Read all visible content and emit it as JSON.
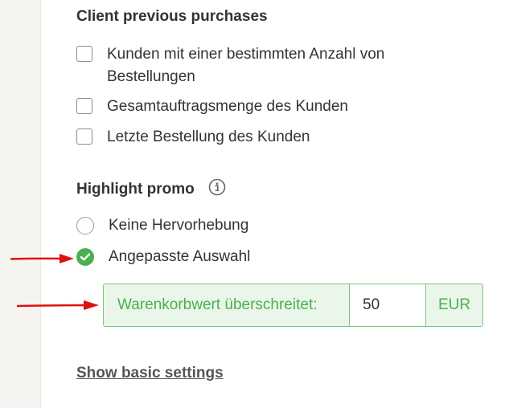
{
  "purchases": {
    "title": "Client previous purchases",
    "options": [
      {
        "line1": "Kunden mit einer bestimmten Anzahl von",
        "line2": "Bestellungen"
      },
      {
        "line1": "Gesamtauftragsmenge des Kunden"
      },
      {
        "line1": "Letzte Bestellung des Kunden"
      }
    ]
  },
  "highlight": {
    "title": "Highlight promo",
    "options": [
      {
        "label": "Keine Hervorhebung",
        "selected": false
      },
      {
        "label": "Angepasste Auswahl",
        "selected": true
      }
    ]
  },
  "threshold": {
    "label": "Warenkorbwert überschreitet:",
    "value": "50",
    "unit": "EUR"
  },
  "footer": {
    "show_basic_label": "Show basic settings"
  },
  "colors": {
    "accent_green": "#4caf50",
    "arrow_red": "#e01010"
  },
  "icons": {
    "info": "info-circle-icon",
    "check": "check-icon",
    "annotation": "red-arrow-icon"
  }
}
